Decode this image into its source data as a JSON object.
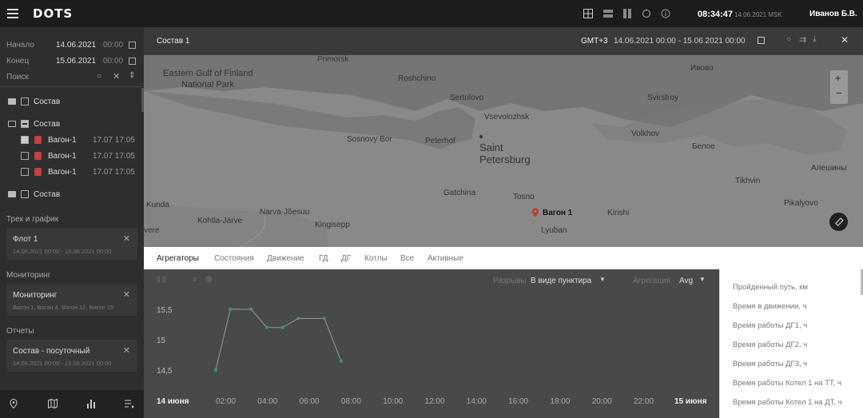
{
  "app": {
    "logo": "DOTS",
    "clock": "08:34:47",
    "clock_date": "14.06.2021 MSK",
    "user": "Иванов Б.В."
  },
  "sidebar": {
    "start_label": "Начало",
    "start_date": "14.06.2021",
    "start_time": "00:00",
    "end_label": "Конец",
    "end_date": "15.06.2021",
    "end_time": "00:00",
    "search_placeholder": "Поиск",
    "tree": [
      {
        "label": "Состав"
      },
      {
        "label": "Состав"
      },
      {
        "label": "Вагон-1",
        "time": "17.07 17:05",
        "checked": true
      },
      {
        "label": "Вагон-1",
        "time": "17.07 17:05",
        "checked": false
      },
      {
        "label": "Вагон-1",
        "time": "17.07 17:05",
        "checked": false
      },
      {
        "label": "Состав"
      }
    ],
    "track_section": "Трек и график",
    "track_card": {
      "title": "Флот 1",
      "subtitle": "14.06.2021 00:00 - 15.06.2021 00:00"
    },
    "monitoring_section": "Мониторинг",
    "monitoring_card": {
      "title": "Мониторинг",
      "subtitle": "Вагон 1, Вагон 4, Вагон 12, Вагон 15"
    },
    "reports_section": "Отчеты",
    "reports_card": {
      "title": "Состав - посуточный",
      "subtitle": "14.06.2021 00:00 - 15.06.2021 00:00"
    }
  },
  "panel": {
    "title": "Состав 1",
    "timezone": "GMT+3",
    "range": "14.06.2021 00:00 - 15.06.2021 00:00"
  },
  "map": {
    "zoom_in": "+",
    "zoom_out": "−",
    "labels": [
      {
        "text": "Primorsk"
      },
      {
        "text": "Eastern Gulf of Finland"
      },
      {
        "text": "National Park"
      },
      {
        "text": "Roshchino"
      },
      {
        "text": "Sertolovo"
      },
      {
        "text": "Vsevolozhsk"
      },
      {
        "text": "Sosnovy Bor"
      },
      {
        "text": "Peterhof"
      },
      {
        "text": "Saint"
      },
      {
        "text": "Petersburg"
      },
      {
        "text": "Gatchina"
      },
      {
        "text": "Tosno"
      },
      {
        "text": "Kunda"
      },
      {
        "text": "Kohtla-Järve"
      },
      {
        "text": "Narva-Jõesuu"
      },
      {
        "text": "Kingisepp"
      },
      {
        "text": "Lyuban"
      },
      {
        "text": "Kirishi"
      },
      {
        "text": "Volkhov"
      },
      {
        "text": "Svirstroy"
      },
      {
        "text": "Ивово"
      },
      {
        "text": "Белое"
      },
      {
        "text": "Tikhvin"
      },
      {
        "text": "Pikalyovo"
      },
      {
        "text": "Алешины"
      },
      {
        "text": "vere"
      }
    ],
    "marker_label": "Вагон 1"
  },
  "tabs": [
    "Агрегаторы",
    "Состояния",
    "Движение",
    "ГД",
    "ДГ",
    "Котлы",
    "Все",
    "Активные"
  ],
  "chart_controls": {
    "breaks_label": "Разрывы",
    "breaks_value": "В виде пунктира",
    "agg_label": "Агрегация",
    "agg_value": "Avg"
  },
  "chart_data": {
    "type": "line",
    "x": [
      "01:00",
      "01:40",
      "03:00",
      "03:40",
      "04:30",
      "05:20",
      "06:20",
      "07:00",
      "07:40"
    ],
    "y": [
      14.5,
      15.5,
      15.5,
      15.2,
      15.2,
      15.35,
      15.35,
      14.65
    ],
    "ytick_labels": [
      "15,5",
      "15",
      "14,5"
    ],
    "xtick_labels": [
      "14 июня",
      "02:00",
      "04:00",
      "06:00",
      "08:00",
      "10:00",
      "12:00",
      "14:00",
      "16:00",
      "18:00",
      "20:00",
      "22:00",
      "15 июня"
    ],
    "color": "#3a9a6a"
  },
  "dropdown": [
    "Пройденный путь, км",
    "Время в движении, ч",
    "Время работы ДГ1, ч",
    "Время работы ДГ2, ч",
    "Время работы ДГ3, ч",
    "Время работы Котел 1 на ТТ, ч",
    "Время работы Котел 1 на ДТ, ч"
  ]
}
